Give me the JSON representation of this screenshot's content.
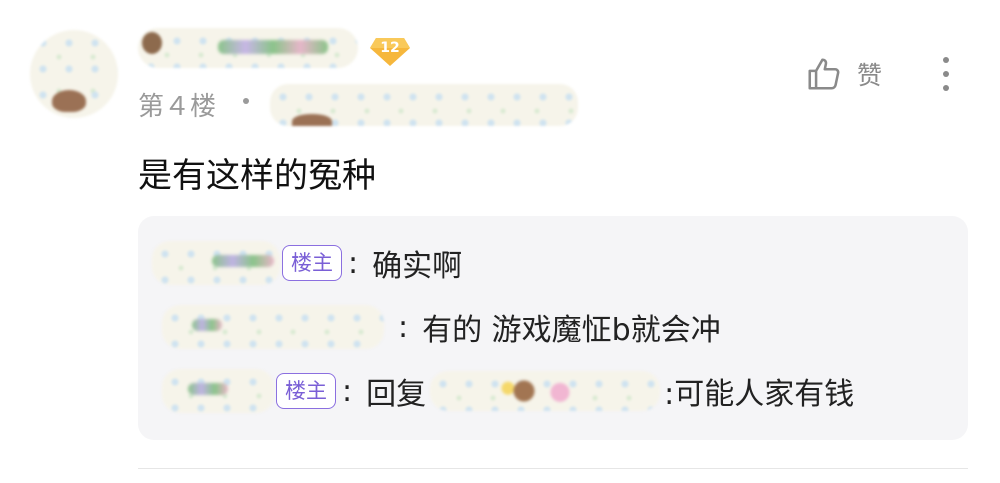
{
  "comment": {
    "level": "12",
    "floor": "第４楼",
    "text": "是有这样的冤种",
    "like_label": "赞"
  },
  "replies": [
    {
      "is_op": true,
      "op_tag": "楼主",
      "text": "确实啊"
    },
    {
      "is_op": false,
      "text": "有的 游戏魔怔b就会冲"
    },
    {
      "is_op": true,
      "op_tag": "楼主",
      "reply_prefix": "回复",
      "text": ":可能人家有钱"
    }
  ],
  "colors": {
    "op_tag": "#8b6fe0",
    "level_badge": "#f6b73c",
    "reply_box_bg": "#f5f5f7"
  },
  "icons": {
    "like": "thumb-up-icon",
    "more": "more-vertical-icon",
    "level": "level-badge-icon"
  }
}
